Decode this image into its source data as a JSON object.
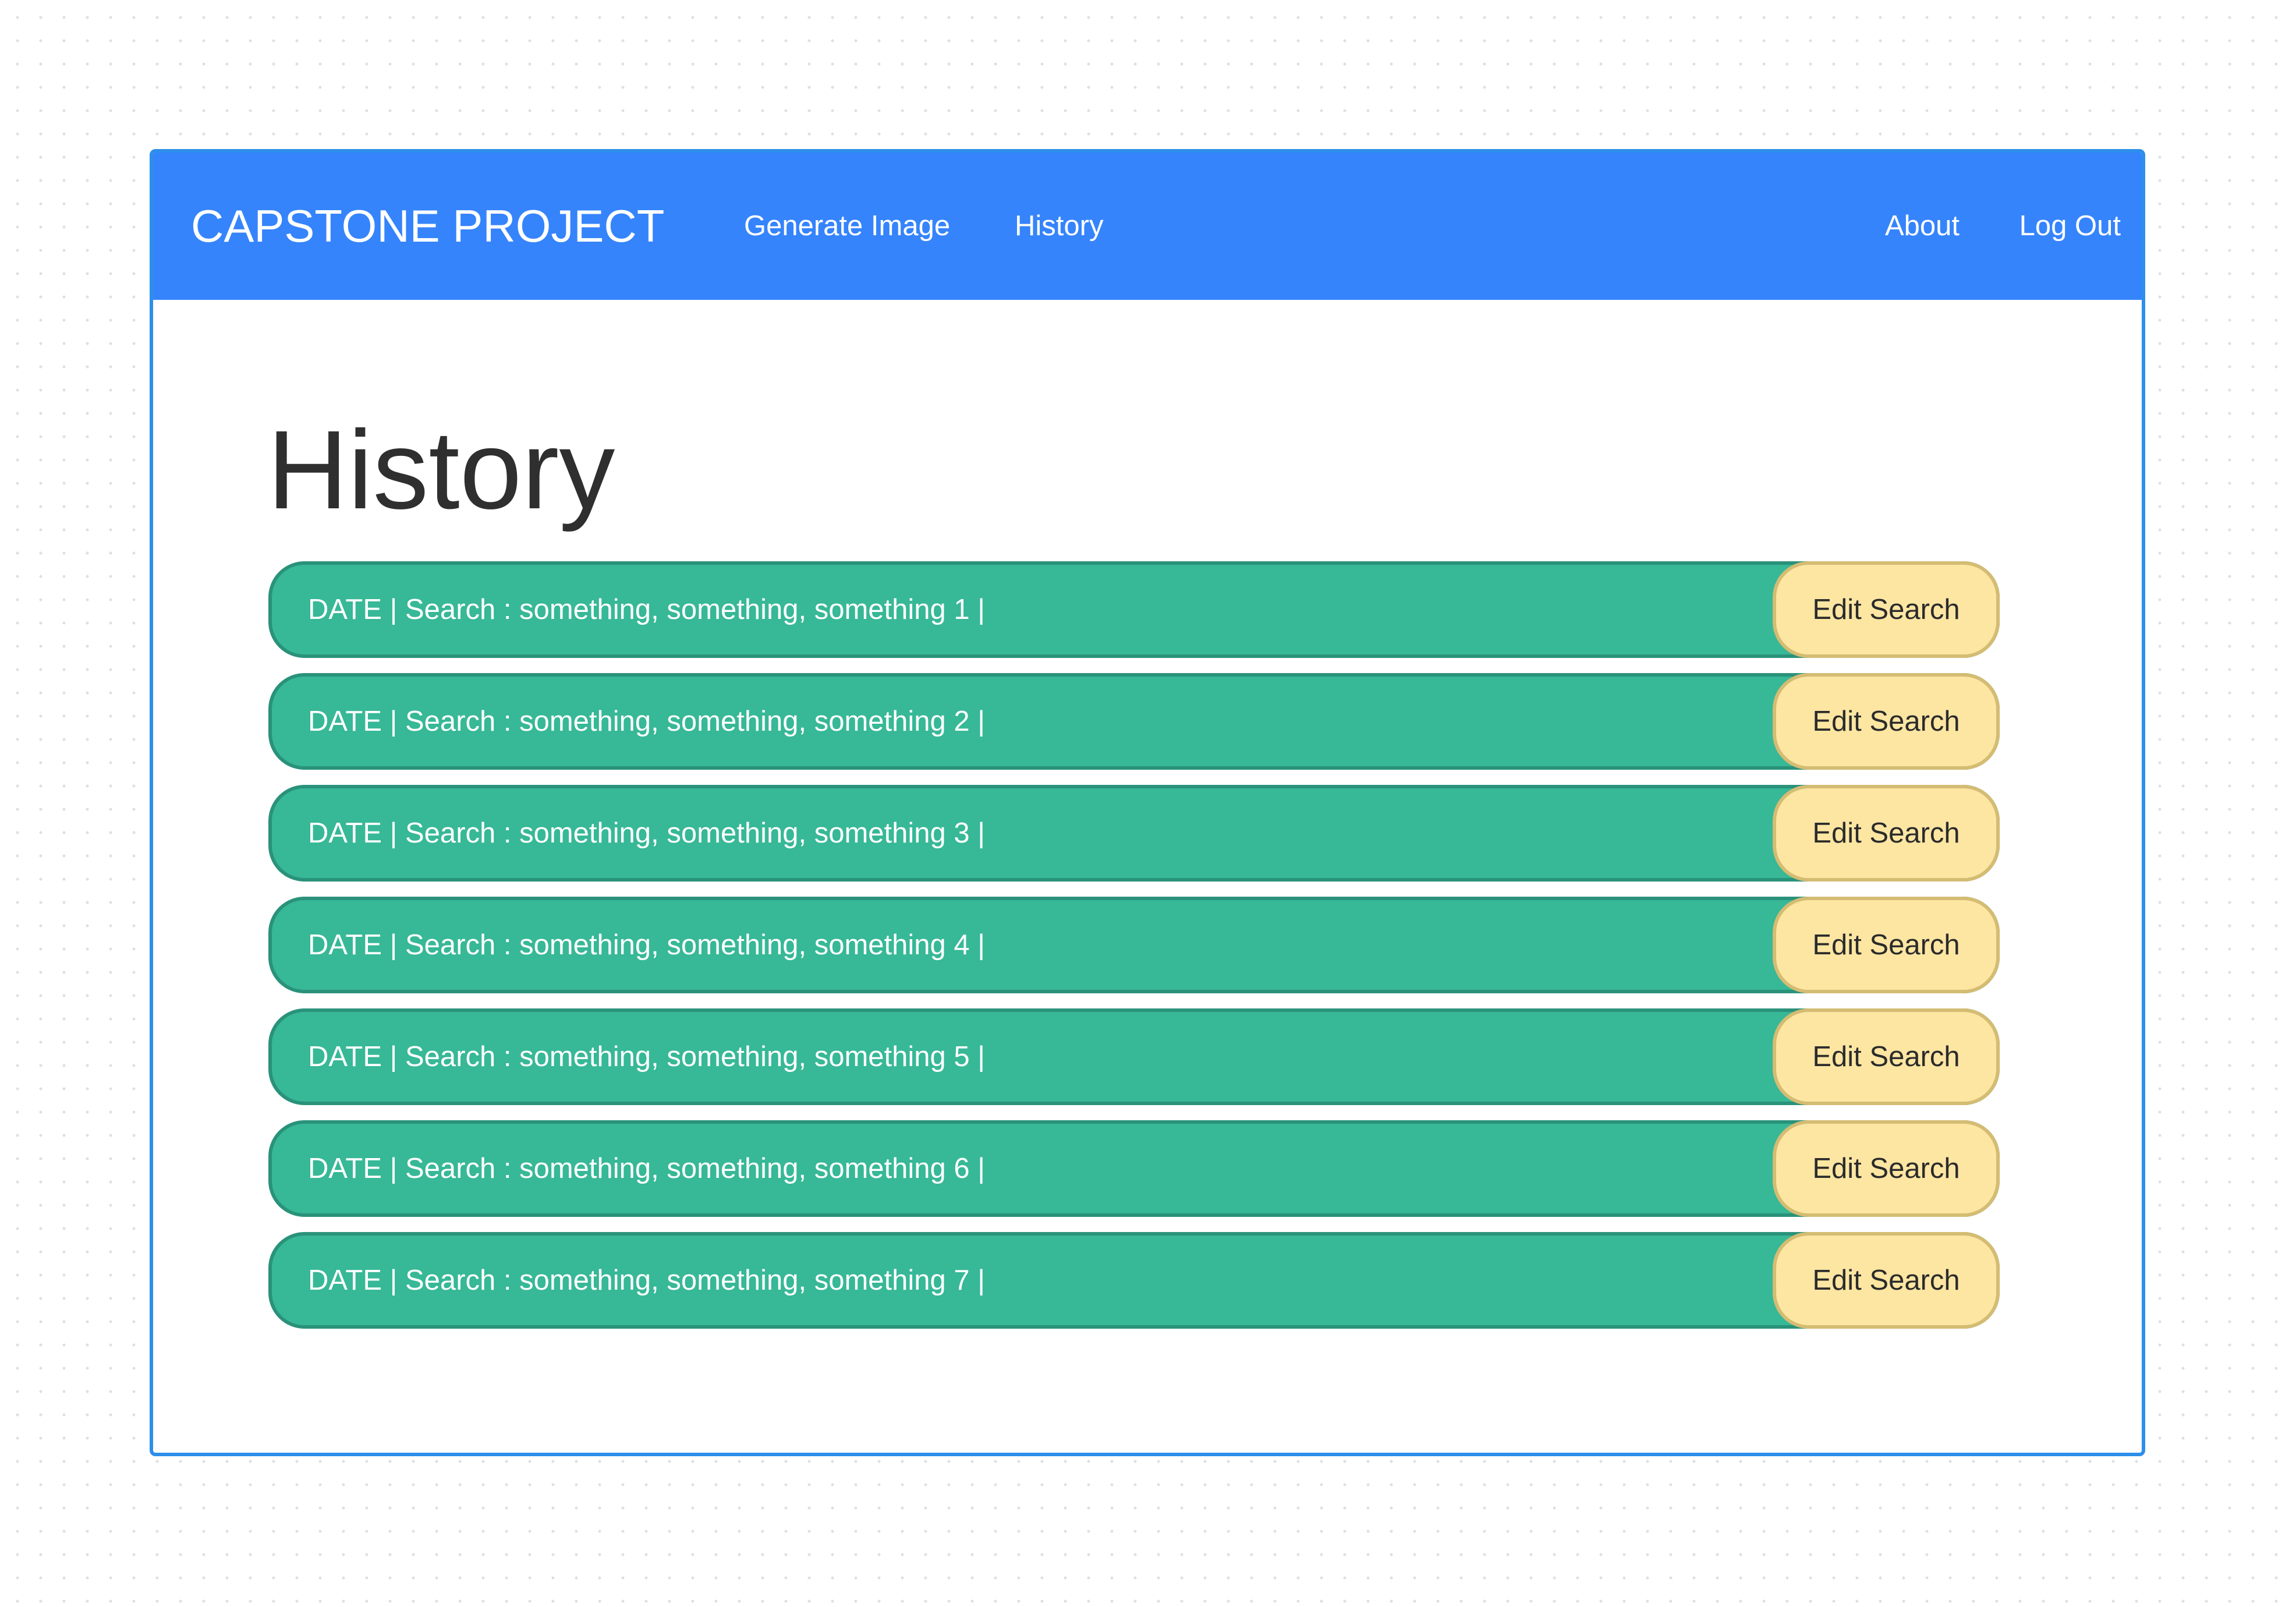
{
  "navbar": {
    "brand": "CAPSTONE PROJECT",
    "links": {
      "generate_image": "Generate Image",
      "history": "History",
      "about": "About",
      "log_out": "Log Out"
    },
    "background_color": "#3584fc"
  },
  "page": {
    "title": "History"
  },
  "history": {
    "items": [
      {
        "text": "DATE | Search : something, something, something 1 |",
        "button": "Edit Search"
      },
      {
        "text": "DATE | Search : something, something, something 2 |",
        "button": "Edit Search"
      },
      {
        "text": "DATE | Search : something, something, something 3 |",
        "button": "Edit Search"
      },
      {
        "text": "DATE | Search : something, something, something 4 |",
        "button": "Edit Search"
      },
      {
        "text": "DATE | Search : something, something, something 5 |",
        "button": "Edit Search"
      },
      {
        "text": "DATE | Search : something, something, something 6 |",
        "button": "Edit Search"
      },
      {
        "text": "DATE | Search : something, something, something 7 |",
        "button": "Edit Search"
      }
    ],
    "row_color": "#37b897",
    "button_color": "#fde6a2"
  }
}
